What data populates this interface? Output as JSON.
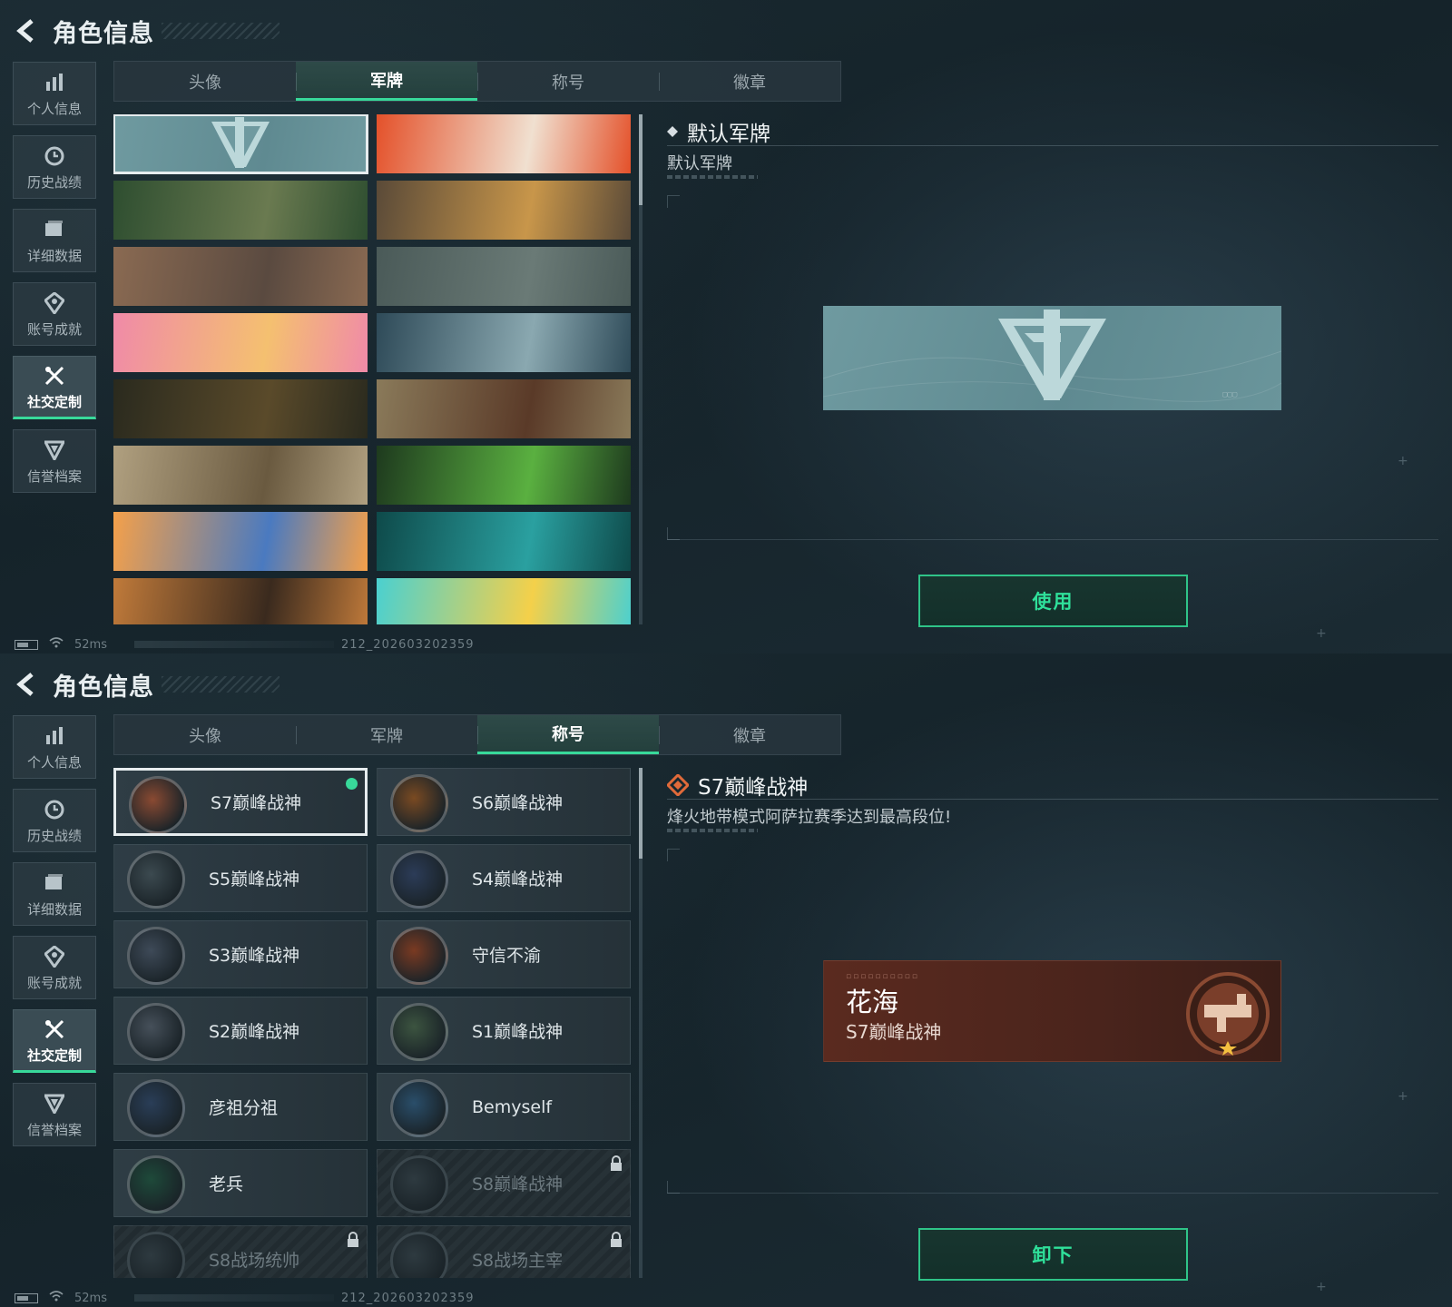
{
  "panel1": {
    "title": "角色信息",
    "nav": [
      {
        "label": "个人信息",
        "icon": "bar-chart-icon"
      },
      {
        "label": "历史战绩",
        "icon": "history-icon"
      },
      {
        "label": "详细数据",
        "icon": "folder-icon"
      },
      {
        "label": "账号成就",
        "icon": "achievement-icon"
      },
      {
        "label": "社交定制",
        "icon": "tools-icon",
        "active": true
      },
      {
        "label": "信誉档案",
        "icon": "shield-icon"
      }
    ],
    "tabs": [
      "头像",
      "军牌",
      "称号",
      "徽章"
    ],
    "active_tab": "军牌",
    "detail": {
      "title": "默认军牌",
      "subtitle": "默认军牌"
    },
    "action": "使用",
    "status": {
      "ping": "52ms",
      "build": "212_202603202359"
    }
  },
  "panel2": {
    "title": "角色信息",
    "nav": [
      {
        "label": "个人信息",
        "icon": "bar-chart-icon"
      },
      {
        "label": "历史战绩",
        "icon": "history-icon"
      },
      {
        "label": "详细数据",
        "icon": "folder-icon"
      },
      {
        "label": "账号成就",
        "icon": "achievement-icon"
      },
      {
        "label": "社交定制",
        "icon": "tools-icon",
        "active": true
      },
      {
        "label": "信誉档案",
        "icon": "shield-icon"
      }
    ],
    "tabs": [
      "头像",
      "军牌",
      "称号",
      "徽章"
    ],
    "active_tab": "称号",
    "titles": [
      {
        "name": "S7巅峰战神",
        "equipped": true,
        "selected": true,
        "color": "#8a4a32"
      },
      {
        "name": "S6巅峰战神",
        "color": "#7a4a22"
      },
      {
        "name": "S5巅峰战神",
        "color": "#3c4a50"
      },
      {
        "name": "S4巅峰战神",
        "color": "#2c3c58"
      },
      {
        "name": "S3巅峰战神",
        "color": "#3e4a58"
      },
      {
        "name": "守信不渝",
        "color": "#7a3a22"
      },
      {
        "name": "S2巅峰战神",
        "color": "#46505a"
      },
      {
        "name": "S1巅峰战神",
        "color": "#3c5440"
      },
      {
        "name": "彦祖分祖",
        "color": "#2a3e58"
      },
      {
        "name": "Bemyself",
        "color": "#2a4e6a"
      },
      {
        "name": "老兵",
        "color": "#1e4a3a"
      },
      {
        "name": "S8巅峰战神",
        "locked": true,
        "color": "#2e3a40"
      },
      {
        "name": "S8战场统帅",
        "locked": true,
        "color": "#2e3a40"
      },
      {
        "name": "S8战场主宰",
        "locked": true,
        "color": "#2e3a40"
      }
    ],
    "detail": {
      "title": "S7巅峰战神",
      "subtitle": "烽火地带模式阿萨拉赛季达到最高段位!"
    },
    "nameplate": {
      "player_name": "花海",
      "title": "S7巅峰战神"
    },
    "action": "卸下",
    "status": {
      "ping": "52ms",
      "build": "212_202603202359"
    }
  },
  "colors": {
    "accent": "#38d99a",
    "bg": "#15232a"
  },
  "dogtags": [
    {
      "id": "default",
      "colors": [
        "#6f9aa0",
        "#5f8a91"
      ],
      "selected": true
    },
    {
      "id": "orange-heli",
      "colors": [
        "#e4512a",
        "#f0e0d0"
      ]
    },
    {
      "id": "green-gear",
      "colors": [
        "#2e4e30",
        "#6a7a50"
      ]
    },
    {
      "id": "desert-soldier",
      "colors": [
        "#5a4a38",
        "#c8964a"
      ]
    },
    {
      "id": "tank-desert",
      "colors": [
        "#8a6a52",
        "#5a4a40"
      ]
    },
    {
      "id": "fog-sniper",
      "colors": [
        "#4a5a58",
        "#6a7a76"
      ]
    },
    {
      "id": "pink-cats",
      "colors": [
        "#f08aa8",
        "#f4c070"
      ]
    },
    {
      "id": "blue-heli",
      "colors": [
        "#2e4a58",
        "#8aa8b0"
      ]
    },
    {
      "id": "dark-rifles",
      "colors": [
        "#2a2a1e",
        "#5a4a2a"
      ]
    },
    {
      "id": "plane-wreck",
      "colors": [
        "#8a7a5a",
        "#5a3a28"
      ]
    },
    {
      "id": "sand-sniper",
      "colors": [
        "#b0a080",
        "#6a5a40"
      ]
    },
    {
      "id": "green-night",
      "colors": [
        "#1e3a1e",
        "#5ab040"
      ]
    },
    {
      "id": "orange-blue-art",
      "colors": [
        "#f4a04a",
        "#4a7ac0"
      ]
    },
    {
      "id": "teal-gym",
      "colors": [
        "#0e4a4a",
        "#2aa0a0"
      ]
    },
    {
      "id": "orange-battle",
      "colors": [
        "#c07a3a",
        "#3a2a1e"
      ]
    },
    {
      "id": "anime-headset",
      "colors": [
        "#4ad0d0",
        "#f4d04a"
      ]
    }
  ]
}
